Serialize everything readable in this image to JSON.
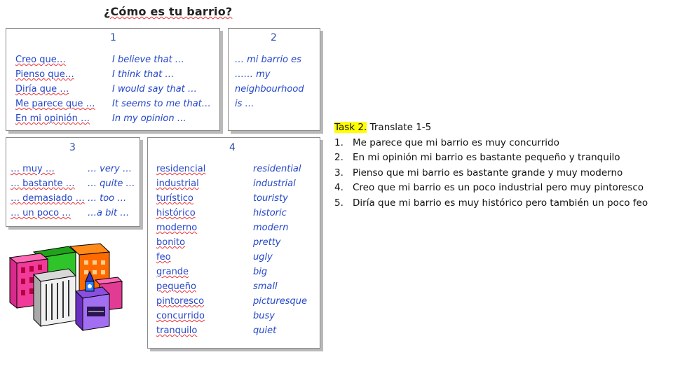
{
  "title": "¿Cómo es tu barrio?",
  "box1": {
    "number": "1",
    "spanish": [
      "Creo que…",
      "Pienso que…",
      "Diría que …",
      "Me parece que …",
      "En mi opinión …"
    ],
    "english": [
      "I believe that …",
      "I think that …",
      "I would say that …",
      "It seems to me that…",
      "In my opinion …"
    ]
  },
  "box2": {
    "number": "2",
    "lines": [
      "… mi barrio es",
      "…… my",
      "neighbourhood",
      "is …"
    ]
  },
  "box3": {
    "number": "3",
    "spanish": [
      "… muy …",
      "… bastante …",
      "… demasiado …",
      "… un poco …"
    ],
    "english": [
      "… very …",
      "… quite …",
      "… too …",
      "…a bit …"
    ]
  },
  "box4": {
    "number": "4",
    "spanish": [
      "residencial",
      "industrial",
      "turístico",
      "histórico",
      "moderno",
      "bonito",
      "feo",
      "grande",
      "pequeño",
      "pintoresco",
      "concurrido",
      "tranquilo"
    ],
    "english": [
      "residential",
      "industrial",
      "touristy",
      "historic",
      "modern",
      "pretty",
      "ugly",
      "big",
      "small",
      "picturesque",
      "busy",
      "quiet"
    ]
  },
  "task": {
    "label": "Task 2.",
    "instruction": " Translate 1-5",
    "items": [
      {
        "n": "1.",
        "text": "Me parece que mi barrio es muy concurrido"
      },
      {
        "n": "2.",
        "text": "En mi opinión mi barrio es bastante pequeño y tranquilo"
      },
      {
        "n": "3.",
        "text": "Pienso que mi barrio es bastante grande y muy moderno"
      },
      {
        "n": "4.",
        "text": "Creo que mi barrio es un poco industrial pero muy pintoresco"
      },
      {
        "n": "5.",
        "text": "Diría que mi barrio es muy histórico pero también un poco feo"
      }
    ]
  },
  "colors": {
    "accent_text": "#2447c9",
    "highlight": "#ffff00"
  },
  "illustration": "city-buildings-clipart"
}
